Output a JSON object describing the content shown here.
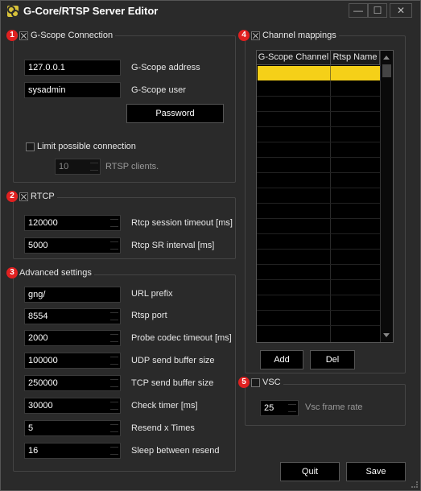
{
  "window": {
    "title": "G-Core/RTSP Server Editor",
    "min": "—",
    "max": "☐",
    "close": "✕"
  },
  "gscope": {
    "badge": "1",
    "title": "G-Scope Connection",
    "checked": true,
    "address_value": "127.0.0.1",
    "address_label": "G-Scope address",
    "user_value": "sysadmin",
    "user_label": "G-Scope user",
    "password_button": "Password",
    "limit_label": "Limit possible connection",
    "limit_checked": false,
    "clients_value": "10",
    "clients_label": "RTSP clients."
  },
  "rtcp": {
    "badge": "2",
    "title": "RTCP",
    "checked": true,
    "session_timeout_value": "120000",
    "session_timeout_label": "Rtcp session timeout [ms]",
    "sr_interval_value": "5000",
    "sr_interval_label": "Rtcp SR interval [ms]"
  },
  "advanced": {
    "badge": "3",
    "title": "Advanced settings",
    "fields": [
      {
        "value": "gng/",
        "label": "URL prefix"
      },
      {
        "value": "8554",
        "label": "Rtsp port"
      },
      {
        "value": "2000",
        "label": "Probe codec timeout [ms]"
      },
      {
        "value": "100000",
        "label": "UDP send buffer size"
      },
      {
        "value": "250000",
        "label": "TCP send buffer size"
      },
      {
        "value": "30000",
        "label": "Check timer [ms]"
      },
      {
        "value": "5",
        "label": "Resend x Times"
      },
      {
        "value": "16",
        "label": "Sleep between resend"
      }
    ]
  },
  "channels": {
    "badge": "4",
    "title": "Channel mappings",
    "checked": true,
    "columns": [
      "G-Scope Channel",
      "Rtsp Name"
    ],
    "add_button": "Add",
    "del_button": "Del",
    "selected_color": "#f5d018"
  },
  "vsc": {
    "badge": "5",
    "title": "VSC",
    "checked": false,
    "frame_rate_value": "25",
    "frame_rate_label": "Vsc frame rate"
  },
  "footer": {
    "quit_button": "Quit",
    "save_button": "Save"
  }
}
